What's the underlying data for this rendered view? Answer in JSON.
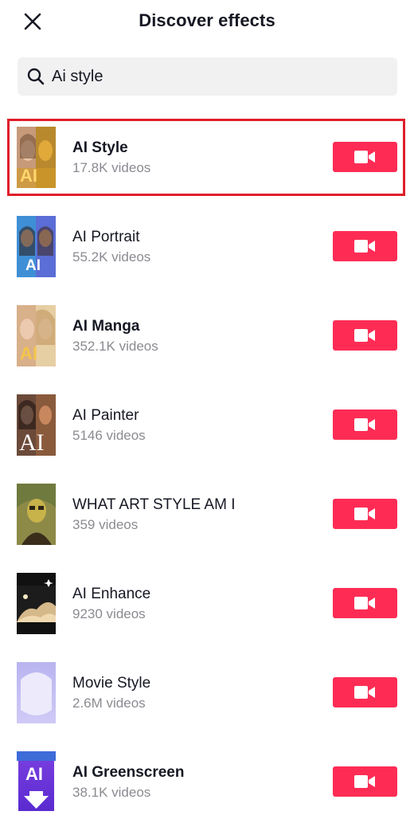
{
  "header": {
    "title": "Discover effects"
  },
  "search": {
    "value": "Ai style"
  },
  "effects": [
    {
      "name": "AI Style",
      "count": "17.8K videos",
      "badge": "AI",
      "bold": true
    },
    {
      "name": "AI Portrait",
      "count": "55.2K videos",
      "badge": "AI",
      "bold": false
    },
    {
      "name": "AI Manga",
      "count": "352.1K videos",
      "badge": "AI",
      "bold": true
    },
    {
      "name": "AI Painter",
      "count": "5146 videos",
      "badge": "AI",
      "bold": false
    },
    {
      "name": "WHAT ART STYLE AM I",
      "count": "359 videos",
      "badge": "",
      "bold": false
    },
    {
      "name": "AI Enhance",
      "count": "9230 videos",
      "badge": "",
      "bold": false
    },
    {
      "name": "Movie Style",
      "count": "2.6M videos",
      "badge": "",
      "bold": false
    },
    {
      "name": "AI Greenscreen",
      "count": "38.1K videos",
      "badge": "AI",
      "bold": true
    }
  ],
  "colors": {
    "record": "#fe2c55",
    "highlight": "#e01e2a",
    "subtext": "#8a8b91"
  },
  "icons": {
    "close": "close-icon",
    "search": "search-icon",
    "record": "video-camera-icon"
  }
}
